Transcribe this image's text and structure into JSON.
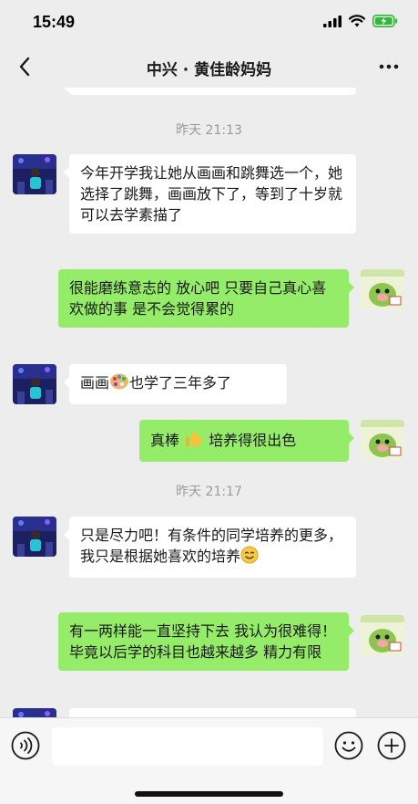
{
  "status": {
    "time": "15:49"
  },
  "header": {
    "title": "中兴 · 黄佳龄妈妈"
  },
  "messages": {
    "ts1": "昨天 21:13",
    "m1": "今年开学我让她从画画和跳舞选一个，她选择了跳舞，画画放下了，等到了十岁就可以去学素描了",
    "m2": "很能磨练意志的 放心吧 只要自己真心喜欢做的事 是不会觉得累的",
    "m3a": "画画",
    "m3b": "也学了三年多了",
    "m4a": "真棒",
    "m4b": " 培养得很出色",
    "ts2": "昨天 21:17",
    "m5": "只是尽力吧！有条件的同学培养的更多，我只是根据她喜欢的培养",
    "m6": "有一两样能一直坚持下去 我认为很难得！毕竟以后学的科目也越来越多 精力有限"
  },
  "input": {
    "placeholder": ""
  },
  "icons": {
    "back": "chevron-left-icon",
    "more": "more-dots-icon",
    "voice": "voice-icon",
    "emoji": "emoji-icon",
    "plus": "plus-icon",
    "palette": "palette-emoji",
    "thumbs_up": "thumbs-up-emoji",
    "smile": "smile-emoji"
  },
  "colors": {
    "background": "#ededed",
    "bubble_sent": "#95ec69",
    "bubble_received": "#ffffff",
    "timestamp": "#9a9a9a"
  }
}
